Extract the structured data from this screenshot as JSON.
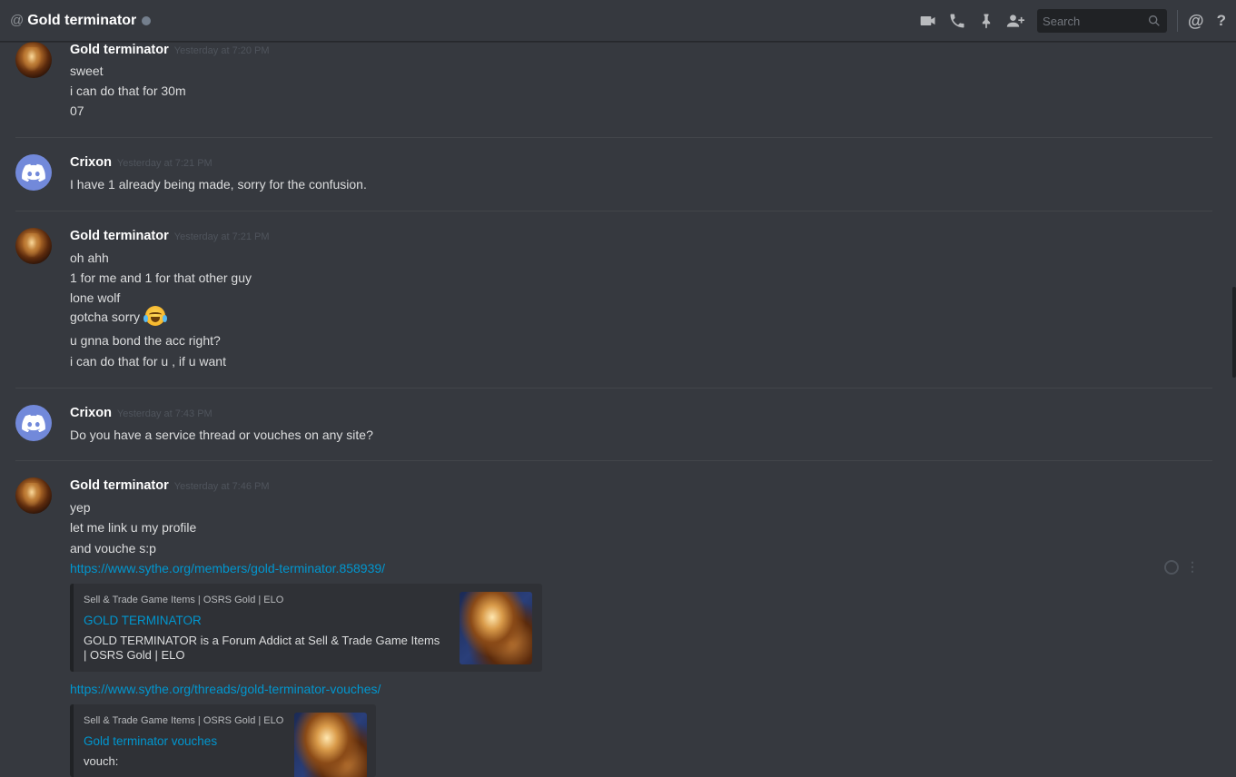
{
  "header": {
    "at_symbol": "@",
    "title": "Gold terminator",
    "search_placeholder": "Search",
    "mention_symbol": "@",
    "help_symbol": "?"
  },
  "messages": [
    {
      "author": "Gold terminator",
      "timestamp": "Yesterday at 7:20 PM",
      "lines": [
        "sweet",
        "i can do that for 30m",
        "07"
      ]
    },
    {
      "author": "Crixon",
      "timestamp": "Yesterday at 7:21 PM",
      "lines": [
        "I have 1 already being made, sorry for the confusion."
      ]
    },
    {
      "author": "Gold terminator",
      "timestamp": "Yesterday at 7:21 PM",
      "lines": [
        "oh ahh",
        "1 for me and 1 for that other guy",
        "lone wolf",
        "gotcha sorry",
        "u gnna bond the acc right?",
        "i can do that for u , if u want"
      ]
    },
    {
      "author": "Crixon",
      "timestamp": "Yesterday at 7:43 PM",
      "lines": [
        "Do you have a service thread or vouches on any site?"
      ]
    },
    {
      "author": "Gold terminator",
      "timestamp": "Yesterday at 7:46 PM",
      "lines": [
        "yep",
        "let me link u my profile",
        "and vouche s:p"
      ],
      "link1": "https://www.sythe.org/members/gold-terminator.858939/",
      "embed1": {
        "provider": "Sell & Trade Game Items | OSRS Gold | ELO",
        "title": "GOLD TERMINATOR",
        "description_line1": "GOLD TERMINATOR is a Forum Addict at Sell & Trade Game Items",
        "description_line2": "| OSRS Gold | ELO"
      },
      "link2": "https://www.sythe.org/threads/gold-terminator-vouches/",
      "embed2": {
        "provider": "Sell & Trade Game Items | OSRS Gold | ELO",
        "title": "Gold terminator vouches",
        "description": "vouch:"
      }
    }
  ],
  "icons": {
    "video_call": "video-camera-icon",
    "voice_call": "phone-icon",
    "pinned": "pin-icon",
    "add_friend": "add-user-icon",
    "search": "magnifier-icon",
    "emoji": "face-with-tears-of-joy"
  },
  "colors": {
    "background": "#36393f",
    "link": "#0096cf",
    "discord_blurple": "#7289da",
    "timestamp": "#4f545c"
  }
}
